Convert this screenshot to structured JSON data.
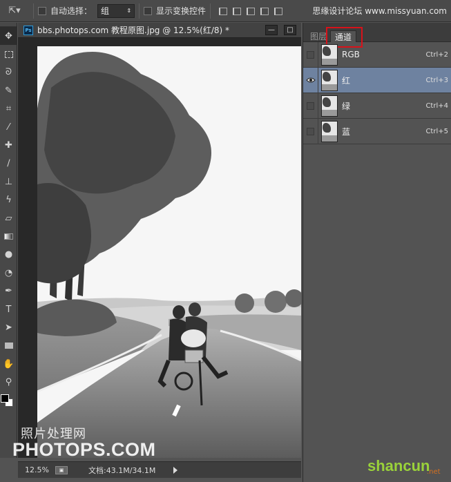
{
  "options_bar": {
    "auto_select_label": "自动选择：",
    "auto_select_value": "组",
    "show_transform_label": "显示变换控件",
    "watermark_text": "思缘设计论坛 www.missyuan.com"
  },
  "document": {
    "title": "bbs.photops.com 教程原图.jpg @ 12.5%(红/8) *",
    "minimize_glyph": "—",
    "maximize_glyph": "□"
  },
  "status": {
    "zoom": "12.5%",
    "doc_size": "文档:43.1M/34.1M"
  },
  "watermark": {
    "cn": "照片处理网",
    "url": "PHOTOPS.COM",
    "brand": "shancun",
    "brand_suffix": ".net"
  },
  "panel": {
    "tabs": [
      {
        "label": "图层",
        "active": false
      },
      {
        "label": "通道",
        "active": true
      }
    ],
    "channels": [
      {
        "name": "RGB",
        "shortcut": "Ctrl+2",
        "visible": false,
        "selected": false
      },
      {
        "name": "红",
        "shortcut": "Ctrl+3",
        "visible": true,
        "selected": true
      },
      {
        "name": "绿",
        "shortcut": "Ctrl+4",
        "visible": false,
        "selected": false
      },
      {
        "name": "蓝",
        "shortcut": "Ctrl+5",
        "visible": false,
        "selected": false
      }
    ]
  },
  "colors": {
    "selected_row": "#6e82a0",
    "highlight_box": "#d8121a",
    "foreground": "#000000",
    "background": "#ffffff"
  },
  "tools": [
    "move-tool-icon",
    "marquee-tool-icon",
    "lasso-tool-icon",
    "quick-select-tool-icon",
    "crop-tool-icon",
    "eyedropper-tool-icon",
    "healing-brush-icon",
    "brush-tool-icon",
    "clone-stamp-icon",
    "history-brush-icon",
    "eraser-tool-icon",
    "gradient-tool-icon",
    "blur-tool-icon",
    "dodge-tool-icon",
    "pen-tool-icon",
    "type-tool-icon",
    "path-select-icon",
    "rectangle-tool-icon",
    "hand-tool-icon",
    "zoom-tool-icon"
  ]
}
